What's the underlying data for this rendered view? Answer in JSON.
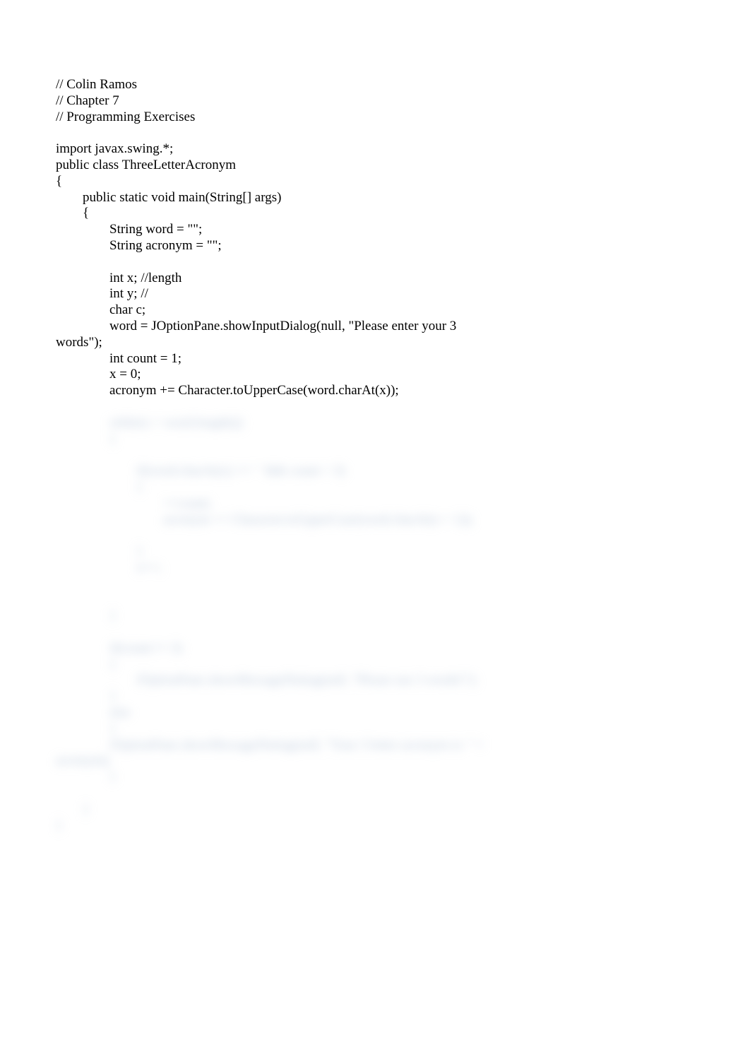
{
  "lines": [
    "// Colin Ramos",
    "// Chapter 7",
    "// Programming Exercises",
    "",
    "import javax.swing.*;",
    "public class ThreeLetterAcronym",
    "{",
    "        public static void main(String[] args)",
    "        {",
    "                String word = \"\";",
    "                String acronym = \"\";",
    "",
    "                int x; //length",
    "                int y; //",
    "                char c;",
    "                word = JOptionPane.showInputDialog(null, \"Please enter your 3 ",
    "words\");",
    "                int count = 1;",
    "                x = 0;",
    "                acronym += Character.toUpperCase(word.charAt(x));",
    ""
  ],
  "blurred_lines": [
    "                while(x < word.length())",
    "                {",
    "",
    "                        if(word.charAt(x) == ' ' && count < 3)",
    "                        {",
    "                                ++count;",
    "                                acronym += Character.toUpperCase(word.charAt(x + 1));",
    "",
    "                        }",
    "                        x++;",
    "",
    "",
    "                }",
    "",
    "                if(count != 3)",
    "                {",
    "                        JOptionPane.showMessageDialog(null, \"Please use 3 words!\");",
    "                }",
    "                else",
    "                {",
    "                JOptionPane.showMessageDialog(null, \"Your 3 letter acronym is: \" + ",
    "acronym);",
    "                }",
    "",
    "        }",
    "}"
  ]
}
